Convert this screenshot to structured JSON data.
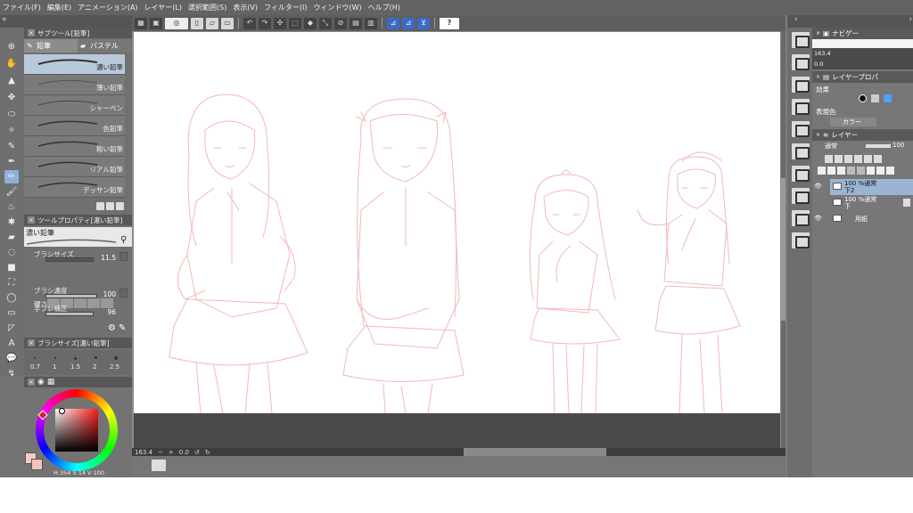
{
  "menu": [
    "ファイル(F)",
    "編集(E)",
    "アニメーション(A)",
    "レイヤー(L)",
    "選択範囲(S)",
    "表示(V)",
    "フィルター(I)",
    "ウィンドウ(W)",
    "ヘルプ(H)"
  ],
  "subtool": {
    "title": "サブツール[鉛筆]",
    "tab_pencil": "鉛筆",
    "tab_pastel": "パステル",
    "brushes": [
      "濃い鉛筆",
      "薄い鉛筆",
      "シャーペン",
      "色鉛筆",
      "粗い鉛筆",
      "リアル鉛筆",
      "デッサン鉛筆"
    ]
  },
  "tool_property": {
    "title": "ツールプロパティ[濃い鉛筆]",
    "brush_name": "濃い鉛筆",
    "brush_size_label": "ブラシサイズ",
    "brush_size_value": "11.5",
    "hardness_label": "硬さ",
    "density_label": "ブラシ濃度",
    "density_value": "100",
    "stabilization_label": "手ブレ補正",
    "stabilization_value": "96"
  },
  "brush_size_panel": {
    "title": "ブラシサイズ[濃い鉛筆]",
    "sizes": [
      "0.7",
      "1",
      "1.5",
      "2",
      "2.5"
    ]
  },
  "color": {
    "h": "354",
    "s": "14",
    "v": "100",
    "main": "#f6c9c9",
    "sub": "#f4c2b6"
  },
  "status": {
    "zoom": "163.4",
    "angle": "0.0"
  },
  "navigator": {
    "title": "ナビゲー",
    "zoom": "163.4",
    "angle": "0.0"
  },
  "layer_property": {
    "title": "レイヤープロパ",
    "effect_label": "効果",
    "display_color_label": "表現色",
    "display_color_value": "カラー"
  },
  "layers": {
    "title": "レイヤー",
    "blend_mode": "通常",
    "opacity": "100",
    "items": [
      {
        "name": "下2",
        "meta": "100 %通常"
      },
      {
        "name": "下",
        "meta": "100 %通常"
      },
      {
        "name": "用紙",
        "meta": ""
      }
    ]
  }
}
